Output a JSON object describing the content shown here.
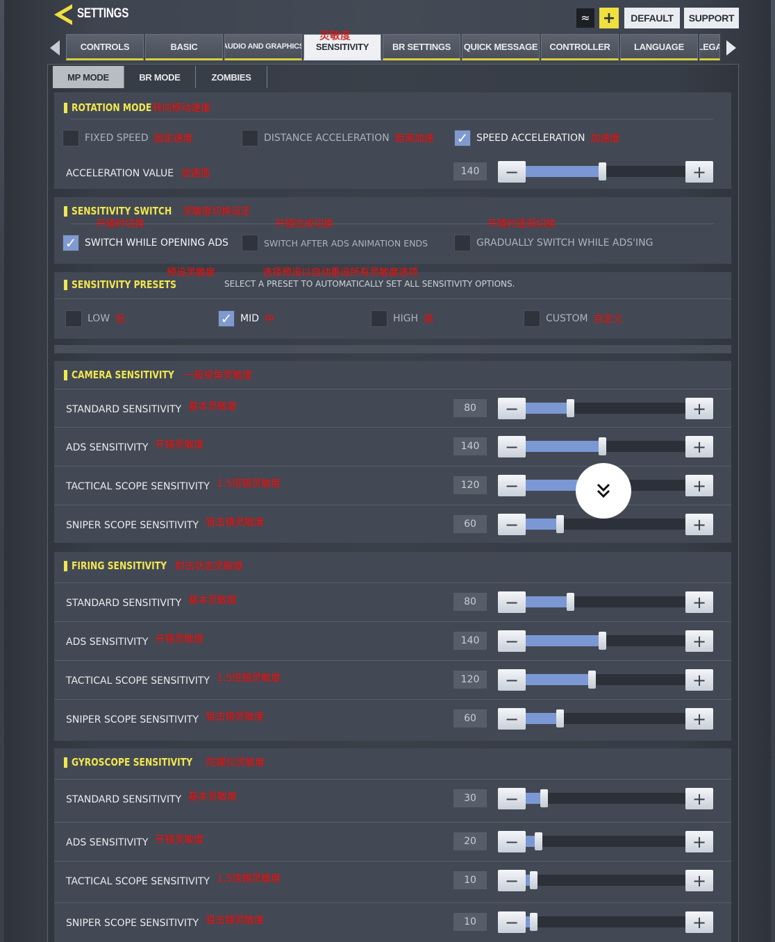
{
  "header": {
    "title": "SETTINGS",
    "buttons": {
      "rank_icon": "chevron-rank-icon",
      "add_label": "+",
      "default_label": "DEFAULT",
      "support_label": "SUPPORT"
    }
  },
  "tabs": [
    {
      "label": "CONTROLS"
    },
    {
      "label": "BASIC"
    },
    {
      "label": "AUDIO AND GRAPHICS"
    },
    {
      "label": "SENSITIVITY",
      "active": true,
      "note": "灵敏度"
    },
    {
      "label": "BR SETTINGS"
    },
    {
      "label": "QUICK MESSAGE"
    },
    {
      "label": "CONTROLLER"
    },
    {
      "label": "LANGUAGE"
    },
    {
      "label": "LEGA"
    }
  ],
  "subtabs": [
    {
      "label": "MP MODE",
      "active": true
    },
    {
      "label": "BR MODE"
    },
    {
      "label": "ZOMBIES"
    }
  ],
  "rotation": {
    "title": "ROTATION MODE",
    "note": "转向移动速度",
    "options": [
      {
        "label": "FIXED SPEED",
        "note": "固定速度",
        "checked": false
      },
      {
        "label": "DISTANCE ACCELERATION",
        "note": "距离加速",
        "checked": false
      },
      {
        "label": "SPEED ACCELERATION",
        "note": "加速度",
        "checked": true
      }
    ],
    "accel": {
      "label": "ACCELERATION VALUE",
      "note": "加速值",
      "value": "140",
      "fraction": 0.467
    }
  },
  "switch": {
    "title": "SENSITIVITY SWITCH",
    "note": "灵敏度切换设定",
    "options": [
      {
        "label": "SWITCH WHILE OPENING ADS",
        "note": "开镜时切换",
        "checked": true
      },
      {
        "label": "SWITCH AFTER ADS ANIMATION ENDS",
        "note": "开镜完成切换",
        "checked": false
      },
      {
        "label": "GRADUALLY SWITCH WHILE ADS'ING",
        "note": "开镜时逐渐切换",
        "checked": false
      }
    ]
  },
  "presets": {
    "title": "SENSITIVITY PRESETS",
    "note": "预设灵敏度",
    "desc": "SELECT A PRESET TO AUTOMATICALLY SET ALL SENSITIVITY OPTIONS.",
    "desc_note": "选择预设以自动重设所有灵敏度选项",
    "options": [
      {
        "label": "LOW",
        "note": "低",
        "checked": false
      },
      {
        "label": "MID",
        "note": "中",
        "checked": true
      },
      {
        "label": "HIGH",
        "note": "高",
        "checked": false
      },
      {
        "label": "CUSTOM",
        "note": "自定义",
        "checked": false
      }
    ]
  },
  "sections": [
    {
      "title": "CAMERA SENSITIVITY",
      "note": "一般视角灵敏度",
      "rows": [
        {
          "label": "STANDARD SENSITIVITY",
          "note": "基本灵敏度",
          "value": "80",
          "fraction": 0.267
        },
        {
          "label": "ADS SENSITIVITY",
          "note": "开镜灵敏度",
          "value": "140",
          "fraction": 0.467
        },
        {
          "label": "TACTICAL SCOPE SENSITIVITY",
          "note": "1.5倍镜灵敏度",
          "value": "120",
          "fraction": 0.4
        },
        {
          "label": "SNIPER SCOPE SENSITIVITY",
          "note": "狙击镜灵敏度",
          "value": "60",
          "fraction": 0.2
        }
      ]
    },
    {
      "title": "FIRING SENSITIVITY",
      "note": "射击状态灵敏度",
      "rows": [
        {
          "label": "STANDARD SENSITIVITY",
          "note": "基本灵敏度",
          "value": "80",
          "fraction": 0.267
        },
        {
          "label": "ADS SENSITIVITY",
          "note": "开镜灵敏度",
          "value": "140",
          "fraction": 0.467
        },
        {
          "label": "TACTICAL SCOPE SENSITIVITY",
          "note": "1.5倍镜灵敏度",
          "value": "120",
          "fraction": 0.4
        },
        {
          "label": "SNIPER SCOPE SENSITIVITY",
          "note": "狙击镜灵敏度",
          "value": "60",
          "fraction": 0.2
        }
      ]
    },
    {
      "title": "GYROSCOPE SENSITIVITY",
      "note": "陀螺仪灵敏度",
      "rows": [
        {
          "label": "STANDARD SENSITIVITY",
          "note": "基本灵敏度",
          "value": "30",
          "fraction": 0.1
        },
        {
          "label": "ADS SENSITIVITY",
          "note": "开镜灵敏度",
          "value": "20",
          "fraction": 0.067
        },
        {
          "label": "TACTICAL SCOPE SENSITIVITY",
          "note": "1.5倍镜灵敏度",
          "value": "10",
          "fraction": 0.033
        },
        {
          "label": "SNIPER SCOPE SENSITIVITY",
          "note": "狙击镜灵敏度",
          "value": "10",
          "fraction": 0.033
        }
      ]
    }
  ],
  "scroll_button": {
    "icon": "double-chevron-down-icon"
  },
  "colors": {
    "accent_yellow": "#f0e650",
    "slider_fill": "#7b98d4",
    "annotation_red": "#d42020"
  }
}
